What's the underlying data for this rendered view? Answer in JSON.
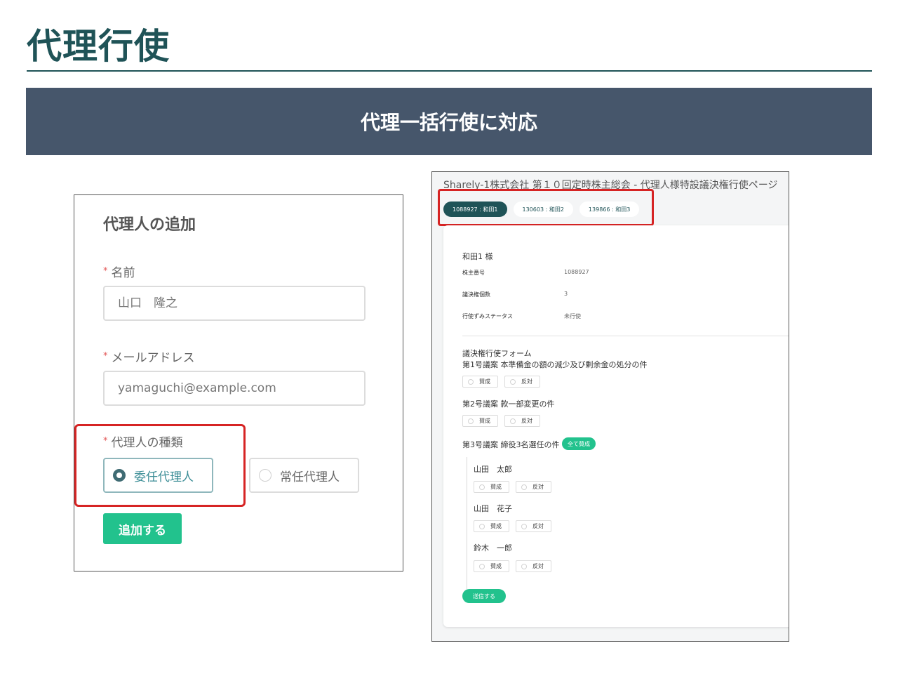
{
  "page": {
    "title": "代理行使",
    "banner": "代理一括行使に対応"
  },
  "add_proxy_form": {
    "title": "代理人の追加",
    "required_mark": "*",
    "name_label": "名前",
    "name_value": "山口　隆之",
    "email_label": "メールアドレス",
    "email_value": "yamaguchi@example.com",
    "type_label": "代理人の種類",
    "type_options": [
      {
        "label": "委任代理人",
        "selected": true
      },
      {
        "label": "常任代理人",
        "selected": false
      }
    ],
    "submit_label": "追加する"
  },
  "voting_page": {
    "heading": "Sharely-1株式会社 第１０回定時株主総会 - 代理人様特設議決権行使ページ",
    "shareholder_tabs": [
      {
        "label": "1088927 : 和田1",
        "active": true
      },
      {
        "label": "130603 : 和田2",
        "active": false
      },
      {
        "label": "139866 : 和田3",
        "active": false
      }
    ],
    "shareholder": {
      "name": "和田1 様",
      "fields": [
        {
          "key": "株主番号",
          "value": "1088927"
        },
        {
          "key": "議決権個数",
          "value": "3"
        },
        {
          "key": "行使ずみステータス",
          "value": "未行使"
        }
      ]
    },
    "form_title": "議決権行使フォーム",
    "approve_label": "賛成",
    "reject_label": "反対",
    "proposals": [
      {
        "title": "第1号議案 本準備金の額の減少及び剰余金の処分の件"
      },
      {
        "title": "第2号議案 款一部変更の件"
      },
      {
        "title": "第3号議案 締役3名選任の件"
      }
    ],
    "approve_all_label": "全て賛成",
    "nominees": [
      "山田　太郎",
      "山田　花子",
      "鈴木　一郎"
    ],
    "submit_label": "送信する"
  },
  "colors": {
    "title": "#1f5357",
    "banner": "#46566b",
    "accent_green": "#22c28d",
    "highlight_red": "#d62424"
  }
}
